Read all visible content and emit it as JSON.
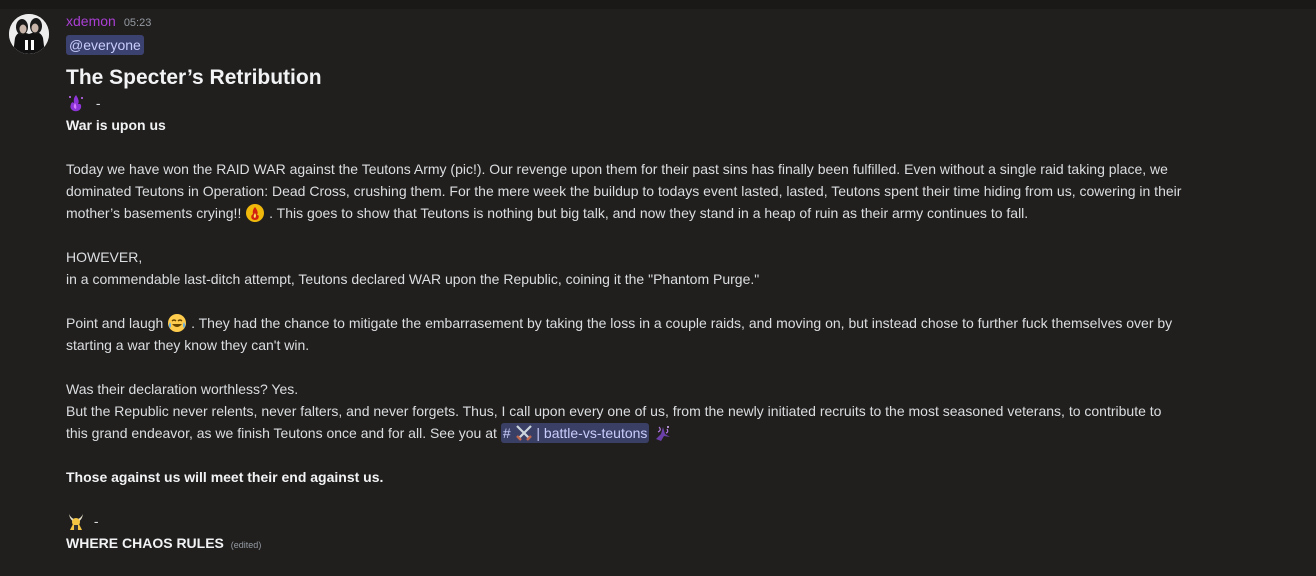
{
  "message": {
    "username": "xdemon",
    "timestamp": "05:23",
    "mention": "@everyone",
    "title": "The Specter’s Retribution",
    "dash_1": "-",
    "section_heading_1": "War is upon us",
    "para_1_line_1": "Today we have won the RAID WAR against the Teutons Army (pic!). Our revenge upon them for their past sins has finally been fulfilled. Even without a single raid taking place, we",
    "para_1_line_2": "dominated Teutons in Operation: Dead Cross, crushing them. For the mere week the buildup to todays event lasted, lasted, Teutons spent their time hiding from us, cowering in their",
    "para_1_line_3a": "mother’s basements crying!!",
    "para_1_line_3b": ". This goes to show that Teutons is nothing but big talk, and now they stand in a heap of ruin as their army continues to fall.",
    "para_2_line_1": "HOWEVER,",
    "para_2_line_2": "in a commendable last-ditch attempt, Teutons declared WAR upon the Republic, coining it the \"Phantom Purge.\"",
    "para_3_line_1a": "Point and laugh",
    "para_3_line_1b": ". They had the chance to mitigate the embarrasement by taking the loss in a couple raids, and moving on, but instead chose to further fuck themselves over by",
    "para_3_line_2": "starting a war they know they can't win.",
    "para_4_line_1": "Was their declaration worthless? Yes.",
    "para_4_line_2": "But the Republic never relents, never falters, and never forgets. Thus, I call upon every one of us, from the newly initiated recruits to the most seasoned veterans, to contribute to",
    "para_4_line_3a": "this grand endeavor, as we finish Teutons once and for all. See you at",
    "channel_hash": "#",
    "channel_name": "| battle-vs-teutons",
    "closing": "Those against us will meet their end against us.",
    "dash_2": "-",
    "section_heading_2": "WHERE CHAOS RULES",
    "edited": "(edited)"
  },
  "icons": {
    "avatar": "user-avatar",
    "emoji_1": "purple-flame-emoji",
    "emoji_2": "fire-emoji",
    "emoji_3": "crying-laughing-emoji",
    "emoji_4": "crossed-swords-emoji",
    "emoji_5": "purple-sparkle-emoji",
    "emoji_6": "horned-figure-emoji"
  },
  "colors": {
    "background": "#211f1d",
    "username": "#a93fd4",
    "mention_bg": "#3c4270",
    "mention_text": "#c9cdfb"
  }
}
